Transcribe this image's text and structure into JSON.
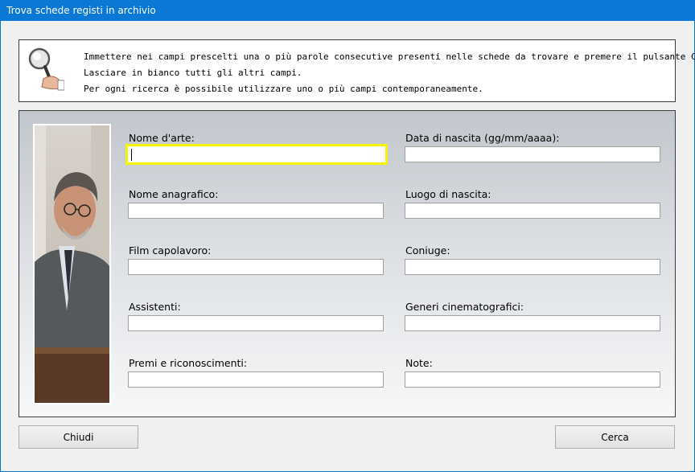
{
  "window": {
    "title": "Trova schede registi in archivio"
  },
  "info": {
    "icon": "magnifier-icon",
    "lines": [
      "Immettere nei campi prescelti una o più parole consecutive presenti nelle schede da trovare e premere il pulsante Cerca.",
      "Lasciare in bianco tutti gli altri campi.",
      "Per ogni ricerca è possibile utilizzare uno o più campi contemporaneamente."
    ]
  },
  "form": {
    "photo": "director-portrait",
    "fields": {
      "nome_arte": {
        "label": "Nome d'arte:",
        "value": ""
      },
      "data_nascita": {
        "label": "Data di nascita (gg/mm/aaaa):",
        "value": ""
      },
      "nome_anagrafico": {
        "label": "Nome anagrafico:",
        "value": ""
      },
      "luogo_nascita": {
        "label": "Luogo di nascita:",
        "value": ""
      },
      "film_capolavoro": {
        "label": "Film capolavoro:",
        "value": ""
      },
      "coniuge": {
        "label": "Coniuge:",
        "value": ""
      },
      "assistenti": {
        "label": "Assistenti:",
        "value": ""
      },
      "generi": {
        "label": "Generi cinematografici:",
        "value": ""
      },
      "premi": {
        "label": "Premi e riconoscimenti:",
        "value": ""
      },
      "note": {
        "label": "Note:",
        "value": ""
      }
    }
  },
  "buttons": {
    "close": "Chiudi",
    "search": "Cerca"
  },
  "colors": {
    "titlebar": "#0a78d4",
    "focus_border": "#f4f40a"
  }
}
